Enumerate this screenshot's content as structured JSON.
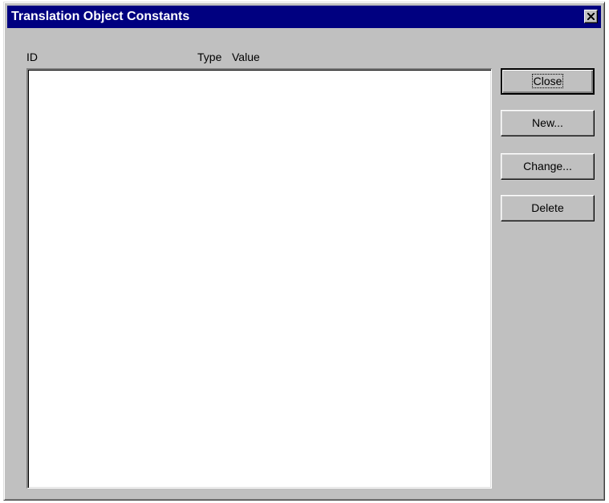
{
  "window": {
    "title": "Translation Object Constants",
    "close_glyph": "✕"
  },
  "list": {
    "columns": [
      "ID",
      "Type",
      "Value"
    ],
    "rows": []
  },
  "buttons": {
    "close": "Close",
    "new": "New...",
    "change": "Change...",
    "delete": "Delete"
  },
  "colors": {
    "titlebar": "#000080",
    "face": "#c0c0c0",
    "list_bg": "#ffffff"
  }
}
